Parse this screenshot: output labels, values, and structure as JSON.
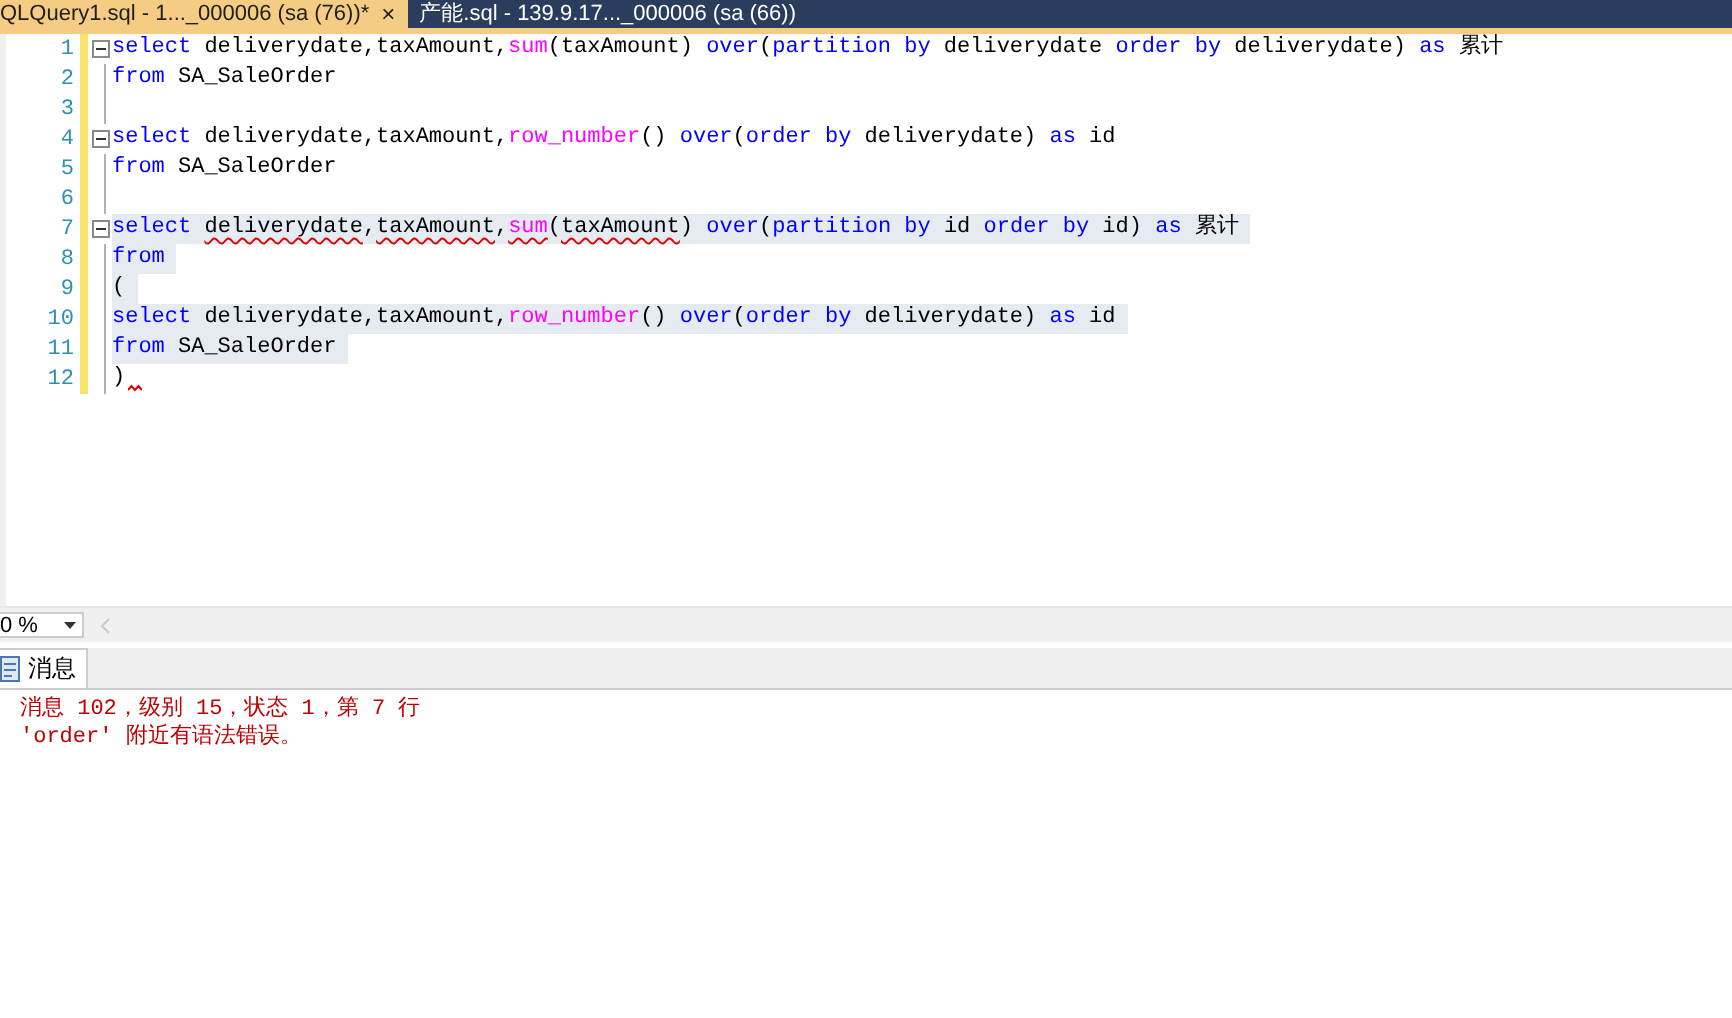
{
  "tabs": [
    {
      "label": "QLQuery1.sql - 1..._000006 (sa (76))*",
      "selected": true,
      "close": "×"
    },
    {
      "label": "产能.sql - 139.9.17..._000006 (sa (66))",
      "selected": false
    }
  ],
  "editor": {
    "lines": [
      {
        "number": "1",
        "fold": true,
        "selected": false,
        "tokens": [
          {
            "text": "select",
            "kind": "kw"
          },
          {
            "text": " deliverydate,taxAmount,",
            "kind": "plain"
          },
          {
            "text": "sum",
            "kind": "fn"
          },
          {
            "text": "(taxAmount) ",
            "kind": "plain"
          },
          {
            "text": "over",
            "kind": "kw"
          },
          {
            "text": "(",
            "kind": "plain"
          },
          {
            "text": "partition by",
            "kind": "kw"
          },
          {
            "text": " deliverydate ",
            "kind": "plain"
          },
          {
            "text": "order by",
            "kind": "kw"
          },
          {
            "text": " deliverydate) ",
            "kind": "plain"
          },
          {
            "text": "as",
            "kind": "kw"
          },
          {
            "text": " 累计",
            "kind": "plain"
          }
        ]
      },
      {
        "number": "2",
        "fold": false,
        "selected": false,
        "tokens": [
          {
            "text": "from",
            "kind": "kw"
          },
          {
            "text": " SA_SaleOrder",
            "kind": "plain"
          }
        ]
      },
      {
        "number": "3",
        "fold": false,
        "selected": false
      },
      {
        "number": "4",
        "fold": true,
        "selected": false,
        "tokens": [
          {
            "text": "select",
            "kind": "kw"
          },
          {
            "text": " deliverydate,taxAmount,",
            "kind": "plain"
          },
          {
            "text": "row_number",
            "kind": "fn"
          },
          {
            "text": "() ",
            "kind": "plain"
          },
          {
            "text": "over",
            "kind": "kw"
          },
          {
            "text": "(",
            "kind": "plain"
          },
          {
            "text": "order by",
            "kind": "kw"
          },
          {
            "text": " deliverydate) ",
            "kind": "plain"
          },
          {
            "text": "as",
            "kind": "kw"
          },
          {
            "text": " id",
            "kind": "plain"
          }
        ]
      },
      {
        "number": "5",
        "fold": false,
        "selected": false,
        "tokens": [
          {
            "text": "from",
            "kind": "kw"
          },
          {
            "text": " SA_SaleOrder",
            "kind": "plain"
          }
        ]
      },
      {
        "number": "6",
        "fold": false,
        "selected": false
      },
      {
        "number": "7",
        "fold": true,
        "selected": true,
        "tokens": [
          {
            "text": "select ",
            "kind": "kw"
          },
          {
            "text": "deliverydate",
            "kind": "plain",
            "squiggle": true
          },
          {
            "text": ",",
            "kind": "plain"
          },
          {
            "text": "taxAmount",
            "kind": "plain",
            "squiggle": true
          },
          {
            "text": ",",
            "kind": "plain"
          },
          {
            "text": "sum",
            "kind": "fn",
            "squiggle": true
          },
          {
            "text": "(",
            "kind": "plain"
          },
          {
            "text": "taxAmount",
            "kind": "plain",
            "squiggle": true
          },
          {
            "text": ") ",
            "kind": "plain"
          },
          {
            "text": "over",
            "kind": "kw"
          },
          {
            "text": "(",
            "kind": "plain"
          },
          {
            "text": "partition by",
            "kind": "kw"
          },
          {
            "text": " id ",
            "kind": "plain"
          },
          {
            "text": "order by",
            "kind": "kw"
          },
          {
            "text": " id) ",
            "kind": "plain"
          },
          {
            "text": "as",
            "kind": "kw"
          },
          {
            "text": " 累计",
            "kind": "plain"
          }
        ]
      },
      {
        "number": "8",
        "fold": false,
        "selected": true,
        "tokens": [
          {
            "text": "from",
            "kind": "kw"
          }
        ]
      },
      {
        "number": "9",
        "fold": false,
        "selected": true,
        "tokens": [
          {
            "text": "(",
            "kind": "plain"
          }
        ]
      },
      {
        "number": "10",
        "fold": false,
        "selected": true,
        "tokens": [
          {
            "text": "select",
            "kind": "kw"
          },
          {
            "text": " deliverydate,taxAmount,",
            "kind": "plain"
          },
          {
            "text": "row_number",
            "kind": "fn"
          },
          {
            "text": "() ",
            "kind": "plain"
          },
          {
            "text": "over",
            "kind": "kw"
          },
          {
            "text": "(",
            "kind": "plain"
          },
          {
            "text": "order by",
            "kind": "kw"
          },
          {
            "text": " deliverydate) ",
            "kind": "plain"
          },
          {
            "text": "as",
            "kind": "kw"
          },
          {
            "text": " id",
            "kind": "plain"
          }
        ]
      },
      {
        "number": "11",
        "fold": false,
        "selected": true,
        "tokens": [
          {
            "text": "from",
            "kind": "kw"
          },
          {
            "text": " SA_SaleOrder",
            "kind": "plain"
          }
        ]
      },
      {
        "number": "12",
        "fold": false,
        "selected": false,
        "error_mark": true,
        "tokens": [
          {
            "text": ")",
            "kind": "plain"
          }
        ]
      }
    ]
  },
  "zoom": {
    "value": "0 %"
  },
  "results": {
    "tab": {
      "label": "消息",
      "selected": true
    },
    "messages": [
      "消息 102，级别 15，状态 1，第 7 行",
      "'order' 附近有语法错误。"
    ]
  }
}
